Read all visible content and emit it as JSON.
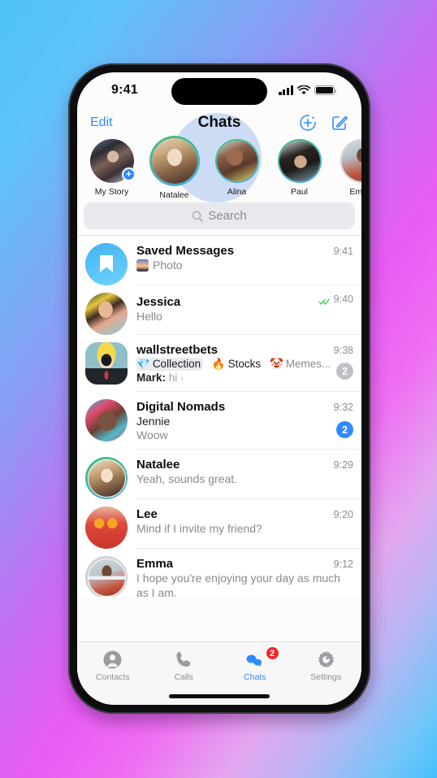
{
  "statusbar": {
    "time": "9:41",
    "signal_icon": "cellular-bars-icon",
    "wifi_icon": "wifi-icon",
    "battery_icon": "battery-icon"
  },
  "header": {
    "edit_label": "Edit",
    "title": "Chats",
    "add_icon": "add-circle-dashed-icon",
    "compose_icon": "compose-icon"
  },
  "stories": [
    {
      "name": "My Story",
      "ring": "none",
      "add": "+",
      "active": false
    },
    {
      "name": "Natalee",
      "ring": "unseen",
      "add": "",
      "active": true
    },
    {
      "name": "Alina",
      "ring": "unseen",
      "add": "",
      "active": false
    },
    {
      "name": "Paul",
      "ring": "unseen",
      "add": "",
      "active": false
    },
    {
      "name": "Emma",
      "ring": "seen",
      "add": "",
      "active": false
    }
  ],
  "search": {
    "placeholder": "Search",
    "icon": "search-icon"
  },
  "chats": [
    {
      "name": "Saved Messages",
      "time": "9:41",
      "snippet": "Photo",
      "has_thumb": true,
      "avatar": "saved-messages-bookmark-icon"
    },
    {
      "name": "Jessica",
      "time": "9:40",
      "snippet": "Hello",
      "read_ticks": true
    },
    {
      "name": "wallstreetbets",
      "time": "9:38",
      "topics": [
        {
          "emoji": "💎",
          "label": "Collection",
          "highlight": true
        },
        {
          "emoji": "🔥",
          "label": "Stocks",
          "highlight": false
        },
        {
          "emoji": "🤡",
          "label": "Memes...",
          "dim": true
        }
      ],
      "mark_sender": "Mark:",
      "mark_message": "hi",
      "badge": "2",
      "badge_style": "gray"
    },
    {
      "name": "Digital Nomads",
      "time": "9:32",
      "sender": "Jennie",
      "snippet": "Woow",
      "badge": "2",
      "badge_style": "blue"
    },
    {
      "name": "Natalee",
      "time": "9:29",
      "snippet": "Yeah, sounds great."
    },
    {
      "name": "Lee",
      "time": "9:20",
      "snippet": "Mind if I invite my friend?"
    },
    {
      "name": "Emma",
      "time": "9:12",
      "snippet": "I hope you're enjoying your day as much as I am."
    }
  ],
  "tabs": [
    {
      "label": "Contacts",
      "icon": "person-circle-icon",
      "active": false,
      "badge": ""
    },
    {
      "label": "Calls",
      "icon": "phone-icon",
      "active": false,
      "badge": ""
    },
    {
      "label": "Chats",
      "icon": "chat-bubbles-icon",
      "active": true,
      "badge": "2"
    },
    {
      "label": "Settings",
      "icon": "gear-icon",
      "active": false,
      "badge": ""
    }
  ],
  "colors": {
    "accent": "#2f8bff",
    "badge_red": "#f02828",
    "tick_green": "#4cd060",
    "muted": "#8e8e93"
  }
}
